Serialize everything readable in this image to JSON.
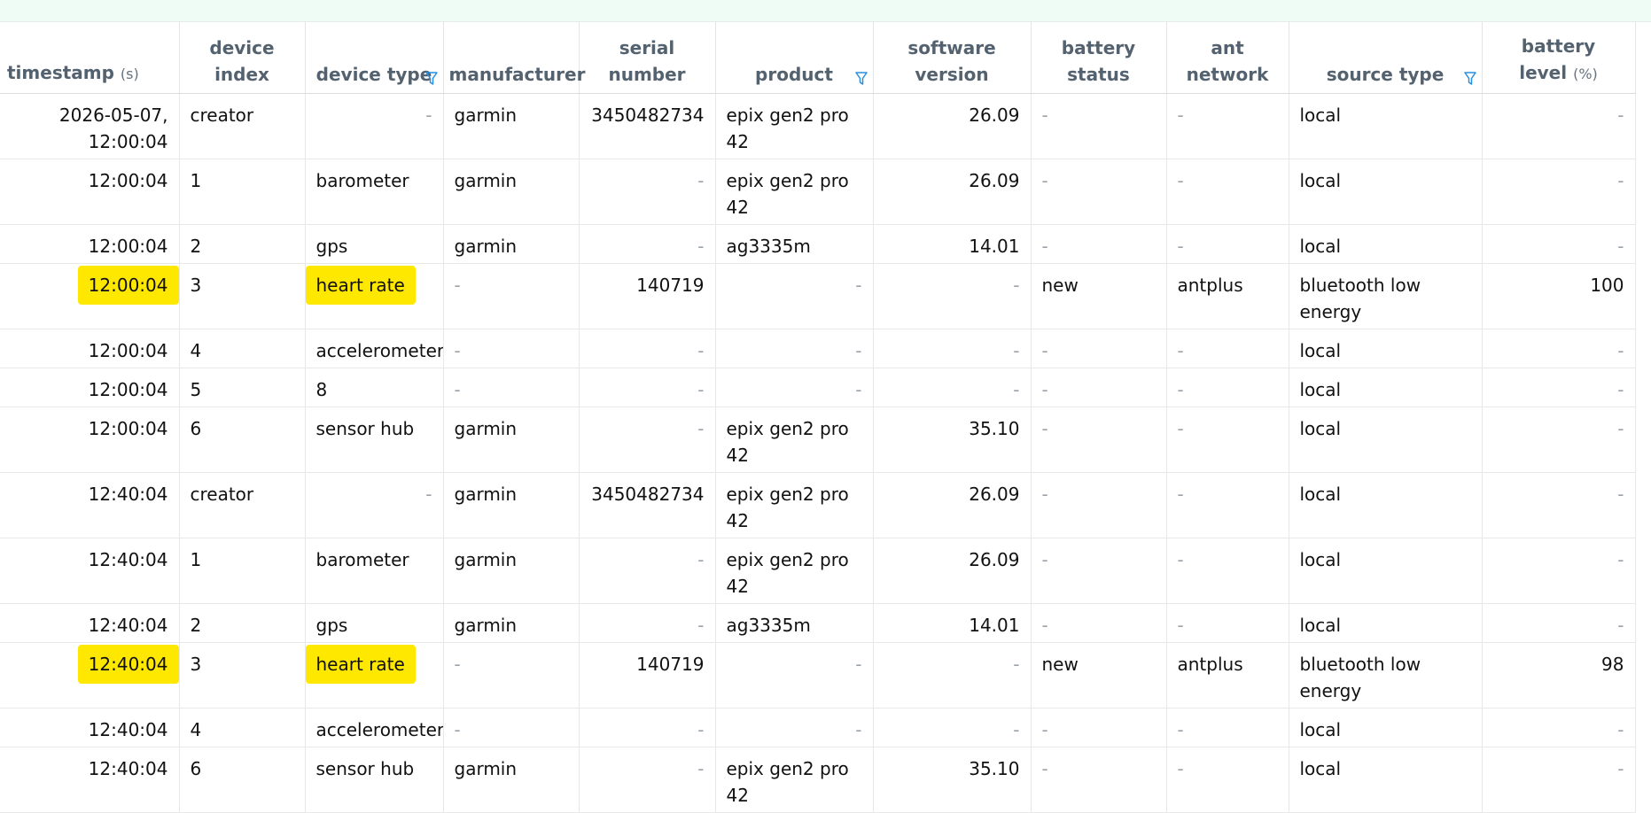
{
  "columns": [
    {
      "label": "timestamp",
      "unit": "(s)",
      "filter": false
    },
    {
      "label": "device\nindex",
      "unit": "",
      "filter": false
    },
    {
      "label": "device type",
      "unit": "",
      "filter": true
    },
    {
      "label": "manufacturer",
      "unit": "",
      "filter": false
    },
    {
      "label": "serial\nnumber",
      "unit": "",
      "filter": false
    },
    {
      "label": "product",
      "unit": "",
      "filter": true
    },
    {
      "label": "software\nversion",
      "unit": "",
      "filter": false
    },
    {
      "label": "battery\nstatus",
      "unit": "",
      "filter": false
    },
    {
      "label": "ant\nnetwork",
      "unit": "",
      "filter": false
    },
    {
      "label": "source type",
      "unit": "",
      "filter": true
    },
    {
      "label": "battery\nlevel",
      "unit": "(%)",
      "filter": false
    }
  ],
  "rows": [
    {
      "timestamp": "2026-05-07,\n12:00:04",
      "device_index": "creator",
      "device_type": "-",
      "manufacturer": "garmin",
      "serial_number": "3450482734",
      "product": "epix gen2 pro 42",
      "software_version": "26.09",
      "battery_status": "-",
      "ant_network": "-",
      "source_type": "local",
      "battery_level": "-",
      "highlight": false
    },
    {
      "timestamp": "12:00:04",
      "device_index": "1",
      "device_type": "barometer",
      "manufacturer": "garmin",
      "serial_number": "-",
      "product": "epix gen2 pro 42",
      "software_version": "26.09",
      "battery_status": "-",
      "ant_network": "-",
      "source_type": "local",
      "battery_level": "-",
      "highlight": false
    },
    {
      "timestamp": "12:00:04",
      "device_index": "2",
      "device_type": "gps",
      "manufacturer": "garmin",
      "serial_number": "-",
      "product": "ag3335m",
      "software_version": "14.01",
      "battery_status": "-",
      "ant_network": "-",
      "source_type": "local",
      "battery_level": "-",
      "highlight": false
    },
    {
      "timestamp": "12:00:04",
      "device_index": "3",
      "device_type": "heart rate",
      "manufacturer": "-",
      "serial_number": "140719",
      "product": "-",
      "software_version": "-",
      "battery_status": "new",
      "ant_network": "antplus",
      "source_type": "bluetooth low energy",
      "battery_level": "100",
      "highlight": true
    },
    {
      "timestamp": "12:00:04",
      "device_index": "4",
      "device_type": "accelerometer",
      "manufacturer": "-",
      "serial_number": "-",
      "product": "-",
      "software_version": "-",
      "battery_status": "-",
      "ant_network": "-",
      "source_type": "local",
      "battery_level": "-",
      "highlight": false
    },
    {
      "timestamp": "12:00:04",
      "device_index": "5",
      "device_type": "8",
      "manufacturer": "-",
      "serial_number": "-",
      "product": "-",
      "software_version": "-",
      "battery_status": "-",
      "ant_network": "-",
      "source_type": "local",
      "battery_level": "-",
      "highlight": false
    },
    {
      "timestamp": "12:00:04",
      "device_index": "6",
      "device_type": "sensor hub",
      "manufacturer": "garmin",
      "serial_number": "-",
      "product": "epix gen2 pro 42",
      "software_version": "35.10",
      "battery_status": "-",
      "ant_network": "-",
      "source_type": "local",
      "battery_level": "-",
      "highlight": false
    },
    {
      "timestamp": "12:40:04",
      "device_index": "creator",
      "device_type": "-",
      "manufacturer": "garmin",
      "serial_number": "3450482734",
      "product": "epix gen2 pro 42",
      "software_version": "26.09",
      "battery_status": "-",
      "ant_network": "-",
      "source_type": "local",
      "battery_level": "-",
      "highlight": false
    },
    {
      "timestamp": "12:40:04",
      "device_index": "1",
      "device_type": "barometer",
      "manufacturer": "garmin",
      "serial_number": "-",
      "product": "epix gen2 pro 42",
      "software_version": "26.09",
      "battery_status": "-",
      "ant_network": "-",
      "source_type": "local",
      "battery_level": "-",
      "highlight": false
    },
    {
      "timestamp": "12:40:04",
      "device_index": "2",
      "device_type": "gps",
      "manufacturer": "garmin",
      "serial_number": "-",
      "product": "ag3335m",
      "software_version": "14.01",
      "battery_status": "-",
      "ant_network": "-",
      "source_type": "local",
      "battery_level": "-",
      "highlight": false
    },
    {
      "timestamp": "12:40:04",
      "device_index": "3",
      "device_type": "heart rate",
      "manufacturer": "-",
      "serial_number": "140719",
      "product": "-",
      "software_version": "-",
      "battery_status": "new",
      "ant_network": "antplus",
      "source_type": "bluetooth low energy",
      "battery_level": "98",
      "highlight": true
    },
    {
      "timestamp": "12:40:04",
      "device_index": "4",
      "device_type": "accelerometer",
      "manufacturer": "-",
      "serial_number": "-",
      "product": "-",
      "software_version": "-",
      "battery_status": "-",
      "ant_network": "-",
      "source_type": "local",
      "battery_level": "-",
      "highlight": false
    },
    {
      "timestamp": "12:40:04",
      "device_index": "6",
      "device_type": "sensor hub",
      "manufacturer": "garmin",
      "serial_number": "-",
      "product": "epix gen2 pro 42",
      "software_version": "35.10",
      "battery_status": "-",
      "ant_network": "-",
      "source_type": "local",
      "battery_level": "-",
      "highlight": false
    }
  ],
  "colors": {
    "highlight": "#ffe800",
    "header_text": "#54626f",
    "filter_icon": "#2a8fe0",
    "top_bar": "#effbf5"
  }
}
